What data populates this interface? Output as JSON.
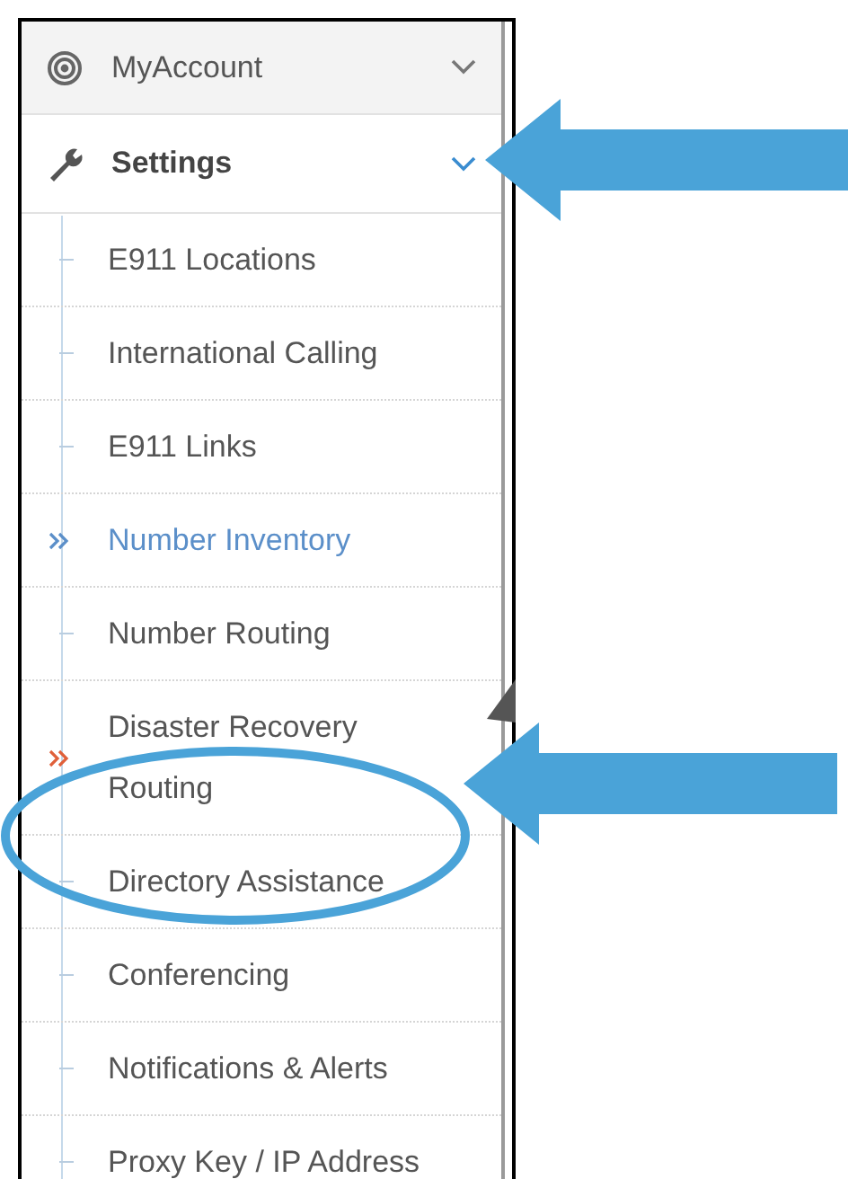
{
  "menu": [
    {
      "label": "MyAccount",
      "kind": "account",
      "expanded": false
    },
    {
      "label": "Settings",
      "kind": "settings",
      "expanded": true,
      "children": [
        {
          "label": "E911 Locations",
          "kind": "dash",
          "selected": false
        },
        {
          "label": "International Calling",
          "kind": "dash",
          "selected": false
        },
        {
          "label": "E911 Links",
          "kind": "dash",
          "selected": false
        },
        {
          "label": "Number Inventory",
          "kind": "chevrons",
          "color": "#5b8fc9",
          "selected": true
        },
        {
          "label": "Number Routing",
          "kind": "dash",
          "selected": false
        },
        {
          "label": "Disaster Recovery Routing",
          "kind": "chevrons",
          "color": "#e0603a",
          "selected": false
        },
        {
          "label": "Directory Assistance",
          "kind": "dash",
          "selected": false
        },
        {
          "label": "Conferencing",
          "kind": "dash",
          "selected": false
        },
        {
          "label": "Notifications & Alerts",
          "kind": "dash",
          "selected": false
        },
        {
          "label": "Proxy Key / IP Address",
          "kind": "dash",
          "selected": false
        }
      ]
    }
  ],
  "annotations": [
    {
      "kind": "arrow"
    },
    {
      "kind": "arrow"
    },
    {
      "kind": "ellipse"
    }
  ]
}
